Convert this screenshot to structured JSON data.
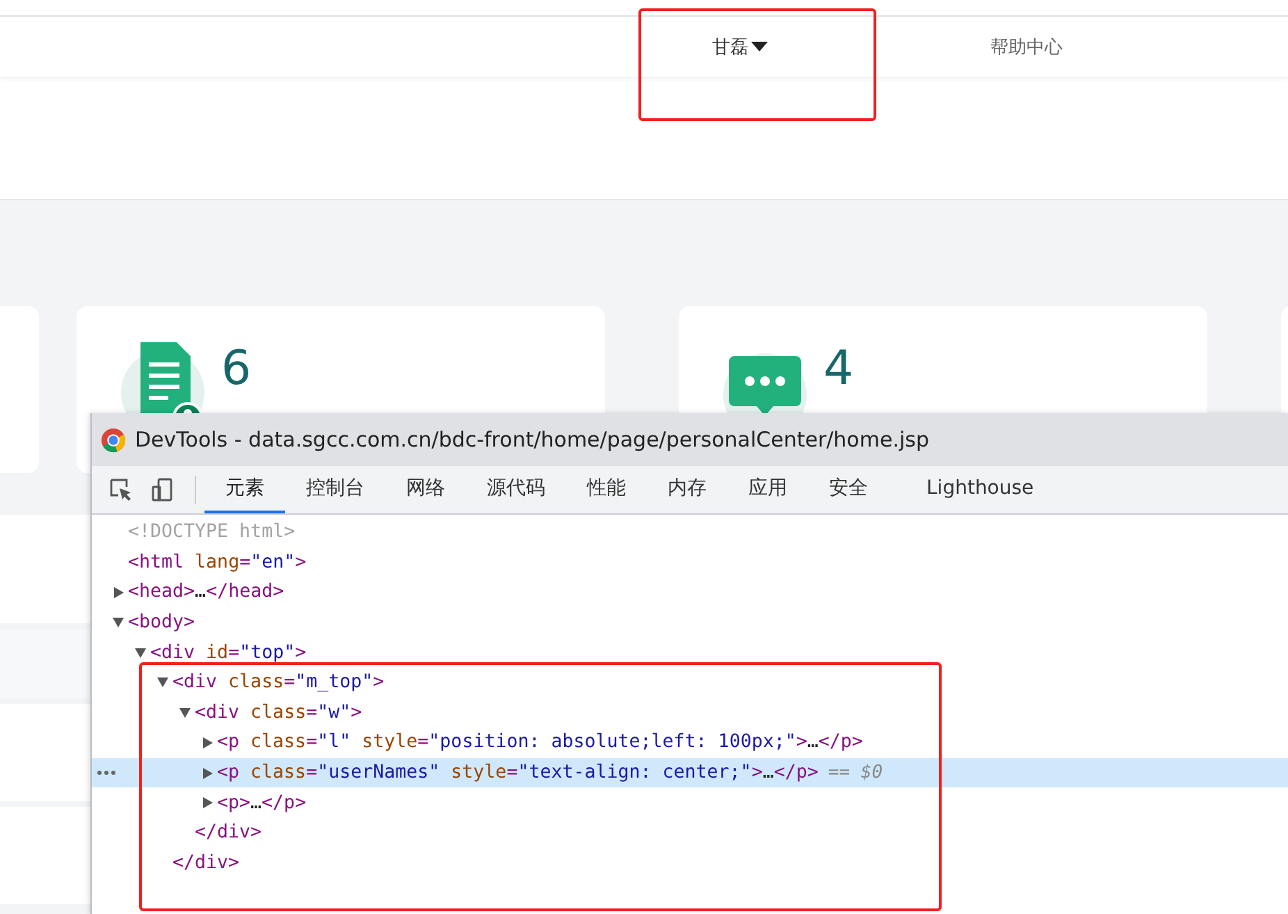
{
  "header": {
    "nav": [
      {
        "label": "甘磊",
        "kind": "dropdown"
      },
      {
        "label": "帮助中心",
        "kind": "link"
      }
    ]
  },
  "cards": [
    {
      "value": "6"
    },
    {
      "value": "4"
    }
  ],
  "devtools": {
    "title": "DevTools - data.sgcc.com.cn/bdc-front/home/page/personalCenter/home.jsp",
    "tabs": [
      {
        "label": "元素",
        "selected": true
      },
      {
        "label": "控制台",
        "selected": false
      },
      {
        "label": "网络",
        "selected": false
      },
      {
        "label": "源代码",
        "selected": false
      },
      {
        "label": "性能",
        "selected": false
      },
      {
        "label": "内存",
        "selected": false
      },
      {
        "label": "应用",
        "selected": false
      },
      {
        "label": "安全",
        "selected": false
      },
      {
        "label": "Lighthouse",
        "selected": false
      }
    ],
    "tree": [
      {
        "text": "<!DOCTYPE html>",
        "kind": "doctype",
        "selected": false
      },
      {
        "text": "<html lang=\"en\">",
        "kind": "tag",
        "selected": false,
        "children": [
          {
            "text": "<head>…</head>",
            "kind": "tag",
            "expanded": false,
            "selected": false
          },
          {
            "text": "<body>",
            "kind": "tag",
            "expanded": true,
            "selected": false,
            "children": [
              {
                "text": "<div id=\"top\">",
                "kind": "tag",
                "expanded": true,
                "selected": false,
                "children": [
                  {
                    "text": "<div class=\"m_top\">",
                    "kind": "tag",
                    "expanded": true,
                    "selected": false,
                    "end": "</div>",
                    "children": [
                      {
                        "text": "<div class=\"w\">",
                        "kind": "tag",
                        "expanded": true,
                        "selected": false,
                        "end": "</div>",
                        "children": [
                          {
                            "text": "<p class=\"l\" style=\"position: absolute;left: 100px;\">…</p>",
                            "kind": "tag",
                            "expanded": false,
                            "selected": false
                          },
                          {
                            "text": "<p class=\"userNames\" style=\"text-align: center;\">…</p>",
                            "kind": "tag",
                            "expanded": false,
                            "selected": true,
                            "note": "== $0"
                          },
                          {
                            "text": "<p>…</p>",
                            "kind": "tag",
                            "expanded": false,
                            "selected": false
                          }
                        ]
                      }
                    ]
                  }
                ]
              }
            ]
          }
        ]
      }
    ]
  }
}
